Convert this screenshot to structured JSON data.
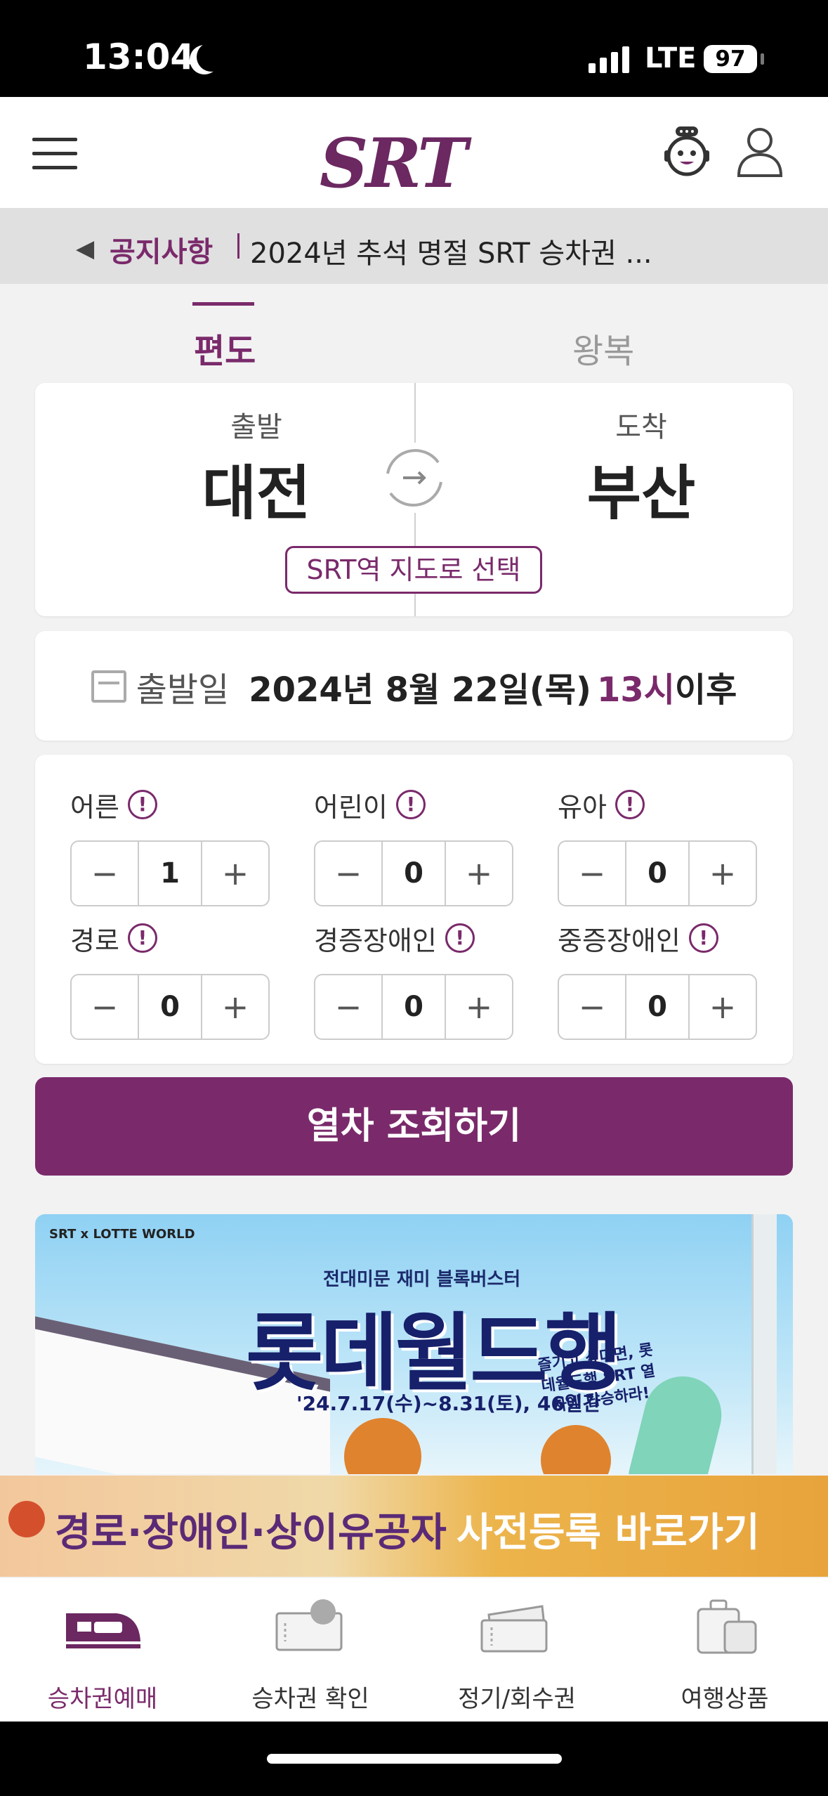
{
  "status_bar": {
    "time": "13:04",
    "network": "LTE",
    "battery": "97"
  },
  "header": {
    "logo": "SRT"
  },
  "notice": {
    "label": "공지사항",
    "text": "2024년 추석 명절 SRT 승차권 ..."
  },
  "trip_tabs": [
    {
      "label": "편도",
      "active": true
    },
    {
      "label": "왕복",
      "active": false
    }
  ],
  "route": {
    "departure_label": "출발",
    "departure_station": "대전",
    "arrival_label": "도착",
    "arrival_station": "부산",
    "map_button": "SRT역 지도로 선택"
  },
  "date": {
    "label": "출발일",
    "value": "2024년 8월 22일(목)",
    "hour": "13시",
    "suffix": "이후"
  },
  "passengers": [
    {
      "label": "어른",
      "count": "1"
    },
    {
      "label": "어린이",
      "count": "0"
    },
    {
      "label": "유아",
      "count": "0"
    },
    {
      "label": "경로",
      "count": "0"
    },
    {
      "label": "경증장애인",
      "count": "0"
    },
    {
      "label": "중증장애인",
      "count": "0"
    }
  ],
  "stepper": {
    "minus": "−",
    "plus": "+",
    "info": "!"
  },
  "search_button": "열차 조회하기",
  "banner": {
    "brand": "SRT x LOTTE WORLD",
    "subtitle": "전대미문 재미 블록버스터",
    "title": "롯데월드행",
    "period": "'24.7.17(수)~8.31(토), 46일간",
    "note": "즐기고 싶다면, 롯데월드행 SRT 열차에 탑승하라!"
  },
  "promo_strip": {
    "part1": "경로·장애인·상이유공자",
    "part2": "사전등록 바로가기"
  },
  "tab_bar": [
    {
      "label": "승차권예매",
      "icon": "train-ticket-icon",
      "active": true
    },
    {
      "label": "승차권 확인",
      "icon": "ticket-check-icon",
      "active": false
    },
    {
      "label": "정기/회수권",
      "icon": "pass-ticket-icon",
      "active": false
    },
    {
      "label": "여행상품",
      "icon": "luggage-icon",
      "active": false
    }
  ],
  "colors": {
    "brand": "#7a2a6b",
    "background": "#f2f2f2"
  }
}
